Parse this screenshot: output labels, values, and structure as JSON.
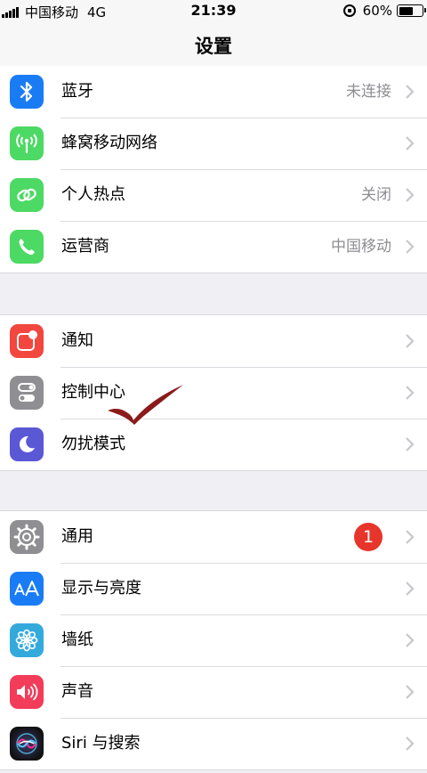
{
  "status_bar": {
    "carrier": "中国移动",
    "network": "4G",
    "time": "21:39",
    "battery_percent": "60%",
    "battery_level": 0.6
  },
  "nav": {
    "title": "设置"
  },
  "groups": [
    {
      "rows": [
        {
          "label": "蓝牙",
          "value": "未连接",
          "icon": "bluetooth-icon",
          "icon_color": "#1a7cf5"
        },
        {
          "label": "蜂窝移动网络",
          "value": "",
          "icon": "cellular-icon",
          "icon_color": "#4cd964"
        },
        {
          "label": "个人热点",
          "value": "关闭",
          "icon": "hotspot-icon",
          "icon_color": "#4cd964"
        },
        {
          "label": "运营商",
          "value": "中国移动",
          "icon": "phone-icon",
          "icon_color": "#4cd964"
        }
      ]
    },
    {
      "rows": [
        {
          "label": "通知",
          "value": "",
          "icon": "notifications-icon",
          "icon_color": "#f2473f"
        },
        {
          "label": "控制中心",
          "value": "",
          "icon": "control-center-icon",
          "icon_color": "#8e8e93"
        },
        {
          "label": "勿扰模式",
          "value": "",
          "icon": "moon-icon",
          "icon_color": "#5b58d6"
        }
      ]
    },
    {
      "rows": [
        {
          "label": "通用",
          "value": "",
          "badge": "1",
          "icon": "gear-icon",
          "icon_color": "#8e8e93"
        },
        {
          "label": "显示与亮度",
          "value": "",
          "icon": "display-icon",
          "icon_color": "#1a7cf5"
        },
        {
          "label": "墙纸",
          "value": "",
          "icon": "wallpaper-icon",
          "icon_color": "#34aadc"
        },
        {
          "label": "声音",
          "value": "",
          "icon": "sound-icon",
          "icon_color": "#f23c5a"
        },
        {
          "label": "Siri 与搜索",
          "value": "",
          "icon": "siri-icon",
          "icon_color": "#1c1c3a"
        }
      ]
    }
  ],
  "annotation": {
    "checkmark_color": "#8b1a1a"
  }
}
